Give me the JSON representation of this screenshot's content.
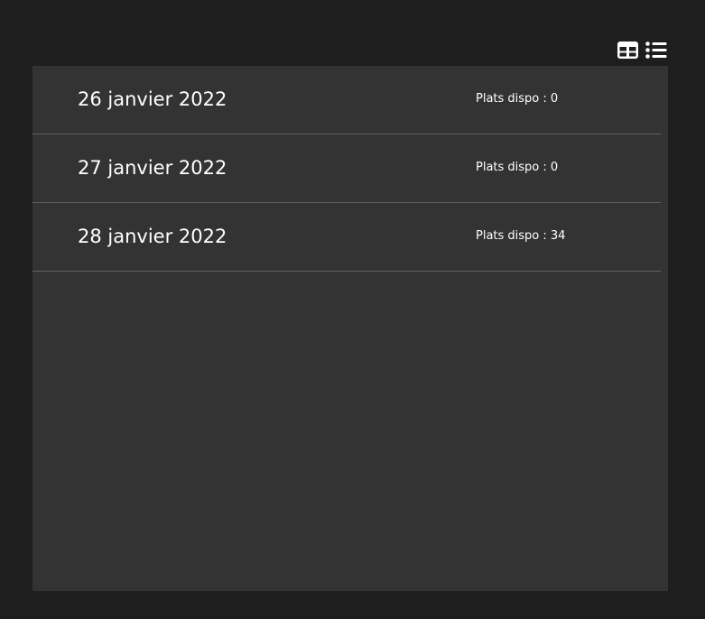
{
  "toolbar": {
    "grid_view_icon": "table-grid-icon",
    "list_view_icon": "list-icon"
  },
  "days": [
    {
      "date": "26 janvier 2022",
      "count_label": "Plats dispo : 0"
    },
    {
      "date": "27 janvier 2022",
      "count_label": "Plats dispo : 0"
    },
    {
      "date": "28 janvier 2022",
      "count_label": "Plats dispo : 34"
    }
  ],
  "colors": {
    "page_background": "#1e1e1e",
    "panel_background": "#333333",
    "divider": "#606060",
    "text": "#ffffff"
  }
}
